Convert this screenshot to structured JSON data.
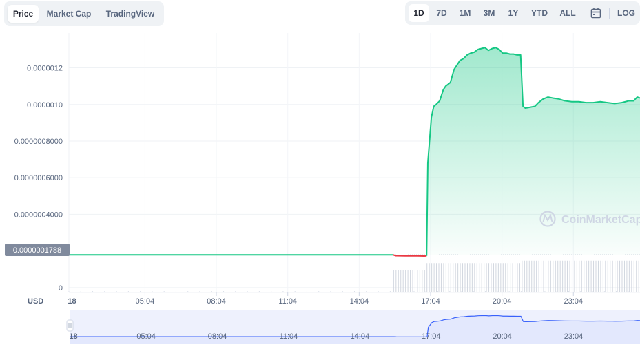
{
  "view_tabs": [
    {
      "label": "Price",
      "active": true
    },
    {
      "label": "Market Cap",
      "active": false
    },
    {
      "label": "TradingView",
      "active": false
    }
  ],
  "range_tabs": [
    {
      "label": "1D",
      "active": true
    },
    {
      "label": "7D",
      "active": false
    },
    {
      "label": "1M",
      "active": false
    },
    {
      "label": "3M",
      "active": false
    },
    {
      "label": "1Y",
      "active": false
    },
    {
      "label": "YTD",
      "active": false
    },
    {
      "label": "ALL",
      "active": false
    }
  ],
  "calendar_icon": "calendar-icon",
  "log_label": "LOG",
  "watermark": "CoinMarketCap",
  "colors": {
    "up": "#16c784",
    "down": "#ea3943",
    "navigator_line": "#3861fb",
    "navigator_fill": "#e3e8fd",
    "price_tag_bg": "#808a9d"
  },
  "chart_data": {
    "type": "area",
    "ylabel": "USD",
    "reference_price": 1.788e-07,
    "reference_label": "0.0000001788",
    "y_ticks": [
      {
        "value": 0,
        "label": "0"
      },
      {
        "value": 4e-07,
        "label": "0.0000004000"
      },
      {
        "value": 6e-07,
        "label": "0.0000006000"
      },
      {
        "value": 8e-07,
        "label": "0.0000008000"
      },
      {
        "value": 1e-06,
        "label": "0.0000010"
      },
      {
        "value": 1.2e-06,
        "label": "0.0000012"
      }
    ],
    "x_ticks": [
      "18",
      "05:04",
      "08:04",
      "11:04",
      "14:04",
      "17:04",
      "20:04",
      "23:04"
    ],
    "x_tick_hours": [
      2.0,
      5.0667,
      8.0667,
      11.0667,
      14.0667,
      17.0667,
      20.0667,
      23.0667
    ],
    "ylim": [
      -2.7e-08,
      1.39e-06
    ],
    "xlim_hours": [
      1.87,
      25.867
    ],
    "series": [
      {
        "segment": "before",
        "x_hours": [
          1.87,
          4.0,
          8.0,
          12.0,
          15.4,
          15.5
        ],
        "values": [
          1.788e-07,
          1.788e-07,
          1.788e-07,
          1.788e-07,
          1.788e-07,
          1.788e-07
        ]
      },
      {
        "segment": "dip",
        "x_hours": [
          15.5,
          15.6,
          16.0,
          16.4,
          16.8,
          16.9
        ],
        "values": [
          1.788e-07,
          1.74e-07,
          1.73e-07,
          1.735e-07,
          1.72e-07,
          1.73e-07
        ]
      },
      {
        "segment": "after",
        "x_hours": [
          16.9,
          16.95,
          17.1,
          17.2,
          17.3,
          17.45,
          17.6,
          17.7,
          17.8,
          17.9,
          18.05,
          18.2,
          18.3,
          18.45,
          18.6,
          18.75,
          18.9,
          19.05,
          19.2,
          19.35,
          19.5,
          19.65,
          19.8,
          19.95,
          20.1,
          20.25,
          20.4,
          20.55,
          20.7,
          20.85,
          20.95,
          21.05,
          21.25,
          21.45,
          21.6,
          21.8,
          22.0,
          22.2,
          22.45,
          22.7,
          23.0,
          23.3,
          23.6,
          23.9,
          24.2,
          24.5,
          24.8,
          25.1,
          25.4,
          25.6,
          25.75,
          25.867
        ],
        "values": [
          1.73e-07,
          6.8e-07,
          9.3e-07,
          9.9e-07,
          1e-06,
          1.02e-06,
          1.08e-06,
          1.1e-06,
          1.11e-06,
          1.12e-06,
          1.19e-06,
          1.22e-06,
          1.24e-06,
          1.25e-06,
          1.27e-06,
          1.28e-06,
          1.285e-06,
          1.3e-06,
          1.305e-06,
          1.31e-06,
          1.295e-06,
          1.305e-06,
          1.31e-06,
          1.3e-06,
          1.28e-06,
          1.28e-06,
          1.275e-06,
          1.275e-06,
          1.27e-06,
          1.27e-06,
          9.9e-07,
          9.8e-07,
          9.85e-07,
          9.9e-07,
          1.01e-06,
          1.03e-06,
          1.04e-06,
          1.035e-06,
          1.03e-06,
          1.02e-06,
          1.015e-06,
          1.015e-06,
          1.01e-06,
          1.01e-06,
          1.015e-06,
          1.01e-06,
          1.005e-06,
          1.01e-06,
          1.02e-06,
          1.02e-06,
          1.04e-06,
          1.035e-06
        ]
      }
    ],
    "volume": {
      "segments": [
        {
          "from_hours": 15.5,
          "to_hours": 16.9,
          "level": 0.55
        },
        {
          "from_hours": 16.9,
          "to_hours": 20.9,
          "level": 0.72
        },
        {
          "from_hours": 20.9,
          "to_hours": 25.867,
          "level": 0.78
        }
      ]
    },
    "navigator": {
      "x_ticks": [
        "18",
        "05:04",
        "08:04",
        "11:04",
        "14:04",
        "17:04",
        "20:04",
        "23:04"
      ]
    }
  }
}
